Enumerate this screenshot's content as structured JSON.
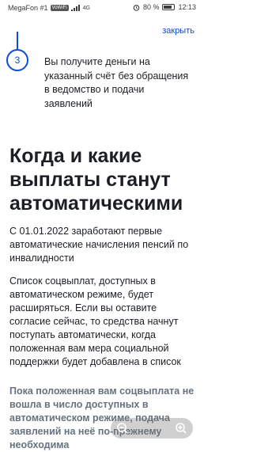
{
  "status_bar": {
    "carrier": "MegaFon #1",
    "network_badge": "VoWiFi",
    "signal_label": "4G",
    "battery_percent": "80 %",
    "time": "12:13",
    "icons": [
      "signal-icon",
      "alarm-icon",
      "battery-icon"
    ]
  },
  "header": {
    "close_label": "закрыть"
  },
  "step": {
    "number": "3",
    "text": "Вы получите деньги на указанный счёт без обращения в ведомство и подачи заявлений"
  },
  "section": {
    "title": "Когда и какие выплаты станут автоматическими",
    "paragraph_1": "С 01.01.2022 заработают первые автоматические начисления пенсий по инвалидности",
    "paragraph_2": "Список соцвыплат, доступных в автоматическом режиме, будет расширяться. Если вы оставите согласие сейчас, то средства начнут поступать автоматически, когда положенная вам мера социальной поддержки будет добавлена в список",
    "paragraph_3": "Пока положенная вам соцвыплата не вошла в число доступных в автоматическом режиме, подача заявлений на неё по-прежнему необходима"
  },
  "colors": {
    "accent": "#0d4cd3",
    "text": "#1b1f24",
    "muted": "#66727f"
  },
  "zoom_controls": {
    "icons": [
      "zoom-out-icon",
      "zoom-in-icon"
    ]
  }
}
